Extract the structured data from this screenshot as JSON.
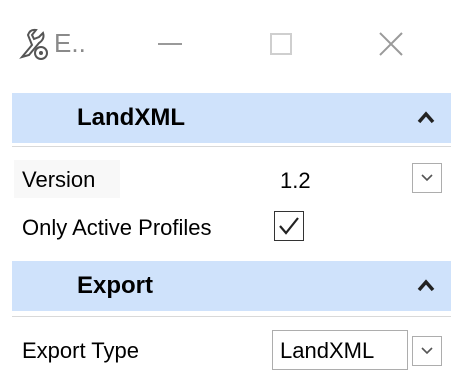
{
  "window": {
    "title": "E..",
    "app_icon": "settings-gear-icon"
  },
  "sections": [
    {
      "title": "LandXML",
      "collapse_icon": "chevron-up-icon",
      "rows": [
        {
          "label": "Version",
          "value": "1.2",
          "control": "dropdown"
        },
        {
          "label": "Only Active Profiles",
          "checked": true,
          "control": "checkbox"
        }
      ]
    },
    {
      "title": "Export",
      "collapse_icon": "chevron-up-icon",
      "rows": [
        {
          "label": "Export Type",
          "value": "LandXML",
          "control": "dropdown"
        }
      ]
    }
  ]
}
